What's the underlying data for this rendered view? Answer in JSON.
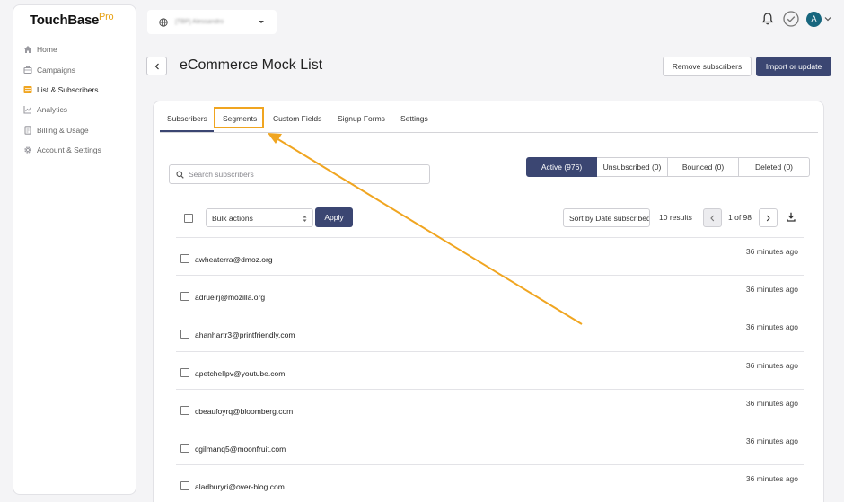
{
  "brand": {
    "name": "TouchBase",
    "suffix": "Pro",
    "accent": "#e8a317"
  },
  "sidebar": {
    "items": [
      {
        "label": "Home",
        "icon": "home-icon",
        "active": false
      },
      {
        "label": "Campaigns",
        "icon": "campaigns-icon",
        "active": false
      },
      {
        "label": "List & Subscribers",
        "icon": "list-icon",
        "active": true
      },
      {
        "label": "Analytics",
        "icon": "analytics-icon",
        "active": false
      },
      {
        "label": "Billing & Usage",
        "icon": "billing-icon",
        "active": false
      },
      {
        "label": "Account & Settings",
        "icon": "gear-icon",
        "active": false
      }
    ]
  },
  "header": {
    "account_name": "[TBP] Alessandro",
    "avatar_initial": "A"
  },
  "page": {
    "title": "eCommerce Mock List",
    "remove_label": "Remove subscribers",
    "import_label": "Import or update"
  },
  "tabs": [
    {
      "label": "Subscribers",
      "active": true
    },
    {
      "label": "Segments",
      "active": false,
      "highlighted": true
    },
    {
      "label": "Custom Fields",
      "active": false
    },
    {
      "label": "Signup Forms",
      "active": false
    },
    {
      "label": "Settings",
      "active": false
    }
  ],
  "search": {
    "placeholder": "Search subscribers",
    "value": ""
  },
  "filters": [
    {
      "label": "Active (976)",
      "selected": true
    },
    {
      "label": "Unsubscribed (0)",
      "selected": false
    },
    {
      "label": "Bounced (0)",
      "selected": false
    },
    {
      "label": "Deleted (0)",
      "selected": false
    }
  ],
  "toolbar": {
    "bulk_label": "Bulk actions",
    "apply_label": "Apply",
    "sort_label": "Sort by Date subscribed",
    "results_label": "10 results",
    "page_info": "1 of 98"
  },
  "subscribers": [
    {
      "email": "awheaterra@dmoz.org",
      "time": "36 minutes ago"
    },
    {
      "email": "adruelrj@mozilla.org",
      "time": "36 minutes ago"
    },
    {
      "email": "ahanhartr3@printfriendly.com",
      "time": "36 minutes ago"
    },
    {
      "email": "apetchellpv@youtube.com",
      "time": "36 minutes ago"
    },
    {
      "email": "cbeaufoyrq@bloomberg.com",
      "time": "36 minutes ago"
    },
    {
      "email": "cgilmanq5@moonfruit.com",
      "time": "36 minutes ago"
    },
    {
      "email": "aladburyri@over-blog.com",
      "time": "36 minutes ago"
    }
  ],
  "colors": {
    "primary": "#3b4672",
    "highlight": "#f0a520",
    "avatar": "#17667e"
  }
}
